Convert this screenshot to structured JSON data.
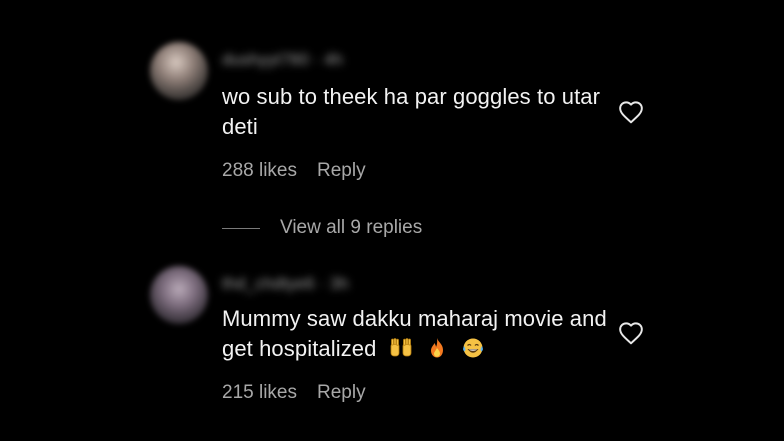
{
  "comments": [
    {
      "username": "dushyyt780 · 4h",
      "text": "wo sub to theek ha par goggles to utar deti",
      "likes": "288 likes",
      "reply": "Reply",
      "icons": [
        "avatar-blurred",
        "heart-icon"
      ]
    },
    {
      "username": "thd_chdtye6 · 3h",
      "text": "Mummy saw dakku maharaj movie and get hospitalized",
      "emojis": [
        "🙌",
        "🔥",
        "😂"
      ],
      "likes": "215 likes",
      "reply": "Reply",
      "icons": [
        "avatar-blurred",
        "heart-icon"
      ]
    }
  ],
  "replies_link": {
    "label": "View all 9 replies"
  },
  "colors": {
    "background": "#000000",
    "primary_text": "#f2f2f2",
    "secondary_text": "#a8a8a8"
  }
}
